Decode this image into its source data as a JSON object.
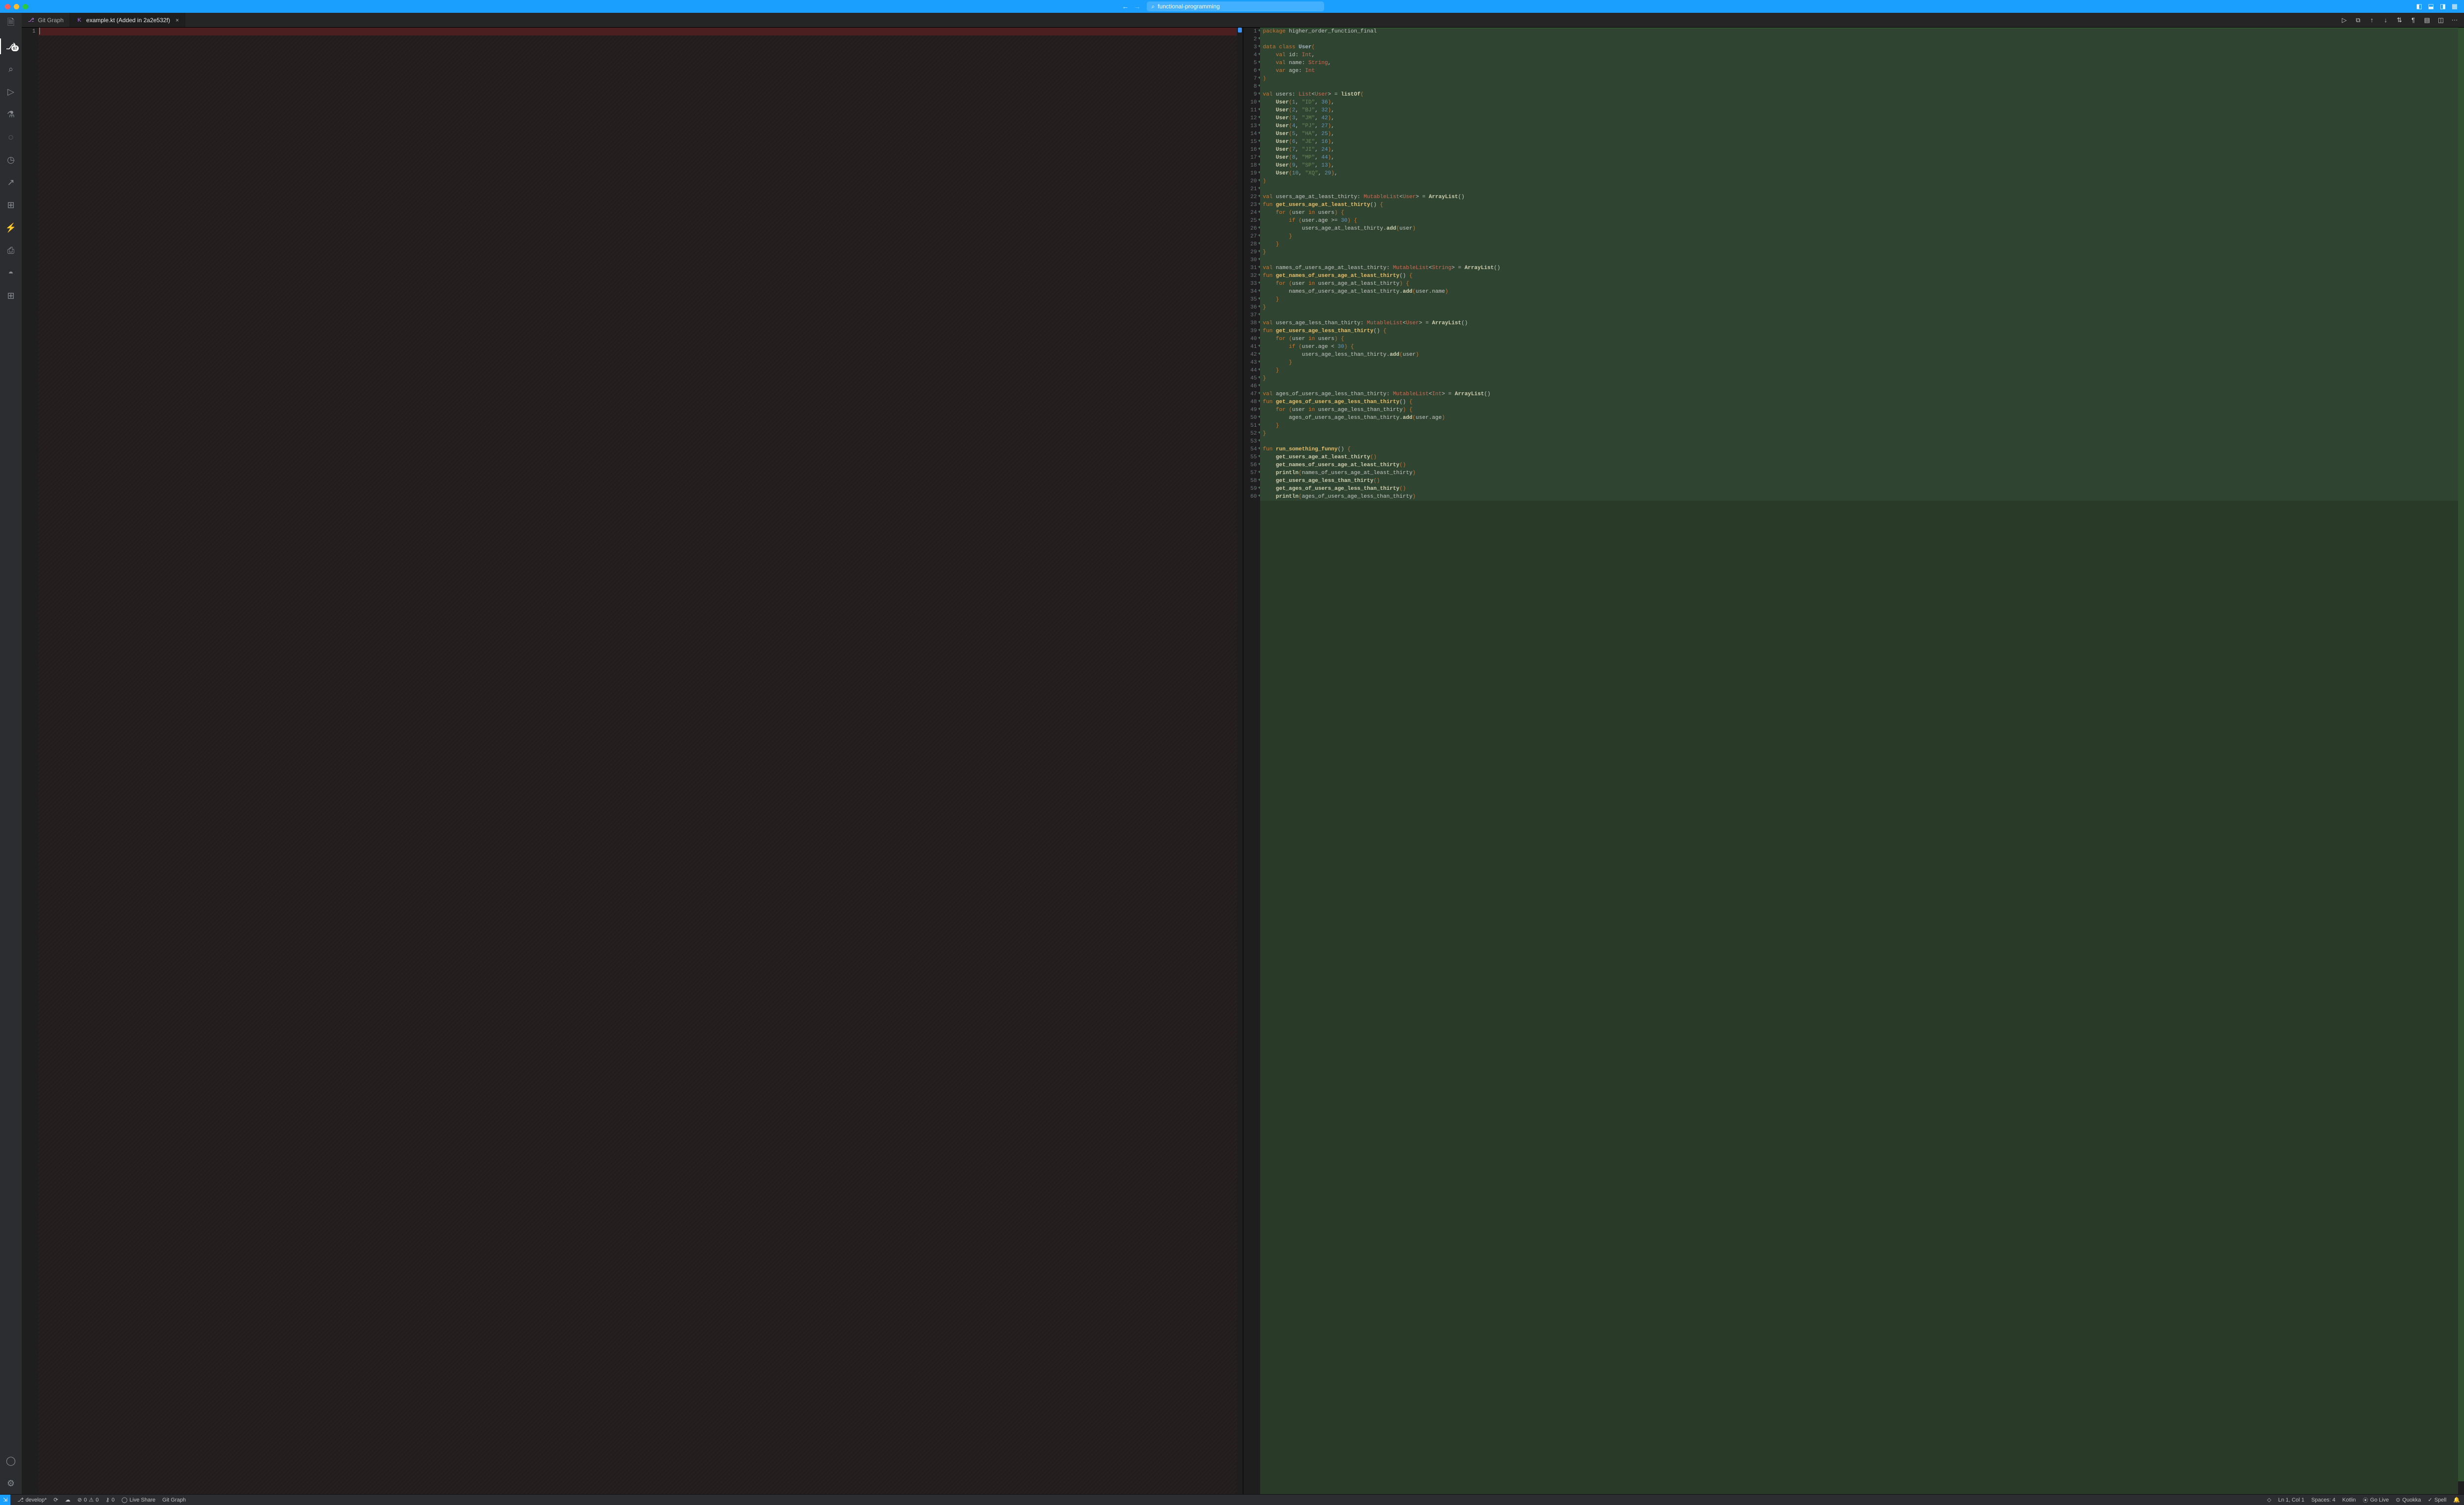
{
  "titlebar": {
    "search_placeholder": "functional-programming"
  },
  "tabs": [
    {
      "label": "Git Graph",
      "icon_name": "git-graph-icon"
    },
    {
      "label": "example.kt (Added in 2a2e532f)",
      "icon_name": "kotlin-file-icon"
    }
  ],
  "activitybar": {
    "scm_badge": "67"
  },
  "diff": {
    "left": {
      "line_numbers": [
        "1"
      ]
    },
    "right": {
      "start_line": 1
    }
  },
  "code": {
    "lines": [
      [
        [
          "k-keyword",
          "package"
        ],
        [
          "k-plain",
          " higher_order_function_final"
        ]
      ],
      [],
      [
        [
          "k-keyword",
          "data class"
        ],
        [
          "k-plain",
          " "
        ],
        [
          "k-class",
          "User"
        ],
        [
          "k-punct",
          "("
        ]
      ],
      [
        [
          "k-plain",
          "    "
        ],
        [
          "k-keyword",
          "val"
        ],
        [
          "k-plain",
          " id: "
        ],
        [
          "k-type",
          "Int"
        ],
        [
          "k-plain",
          ","
        ]
      ],
      [
        [
          "k-plain",
          "    "
        ],
        [
          "k-keyword",
          "val"
        ],
        [
          "k-plain",
          " name: "
        ],
        [
          "k-type",
          "String"
        ],
        [
          "k-plain",
          ","
        ]
      ],
      [
        [
          "k-plain",
          "    "
        ],
        [
          "k-keyword",
          "var"
        ],
        [
          "k-plain",
          " age: "
        ],
        [
          "k-type",
          "Int"
        ]
      ],
      [
        [
          "k-punct",
          ")"
        ]
      ],
      [],
      [
        [
          "k-keyword",
          "val"
        ],
        [
          "k-plain",
          " users: "
        ],
        [
          "k-type",
          "List"
        ],
        [
          "k-plain",
          "<"
        ],
        [
          "k-type",
          "User"
        ],
        [
          "k-plain",
          "> = "
        ],
        [
          "k-call",
          "listOf"
        ],
        [
          "k-punct",
          "("
        ]
      ],
      [
        [
          "k-plain",
          "    "
        ],
        [
          "k-call",
          "User"
        ],
        [
          "k-punct",
          "("
        ],
        [
          "k-number",
          "1"
        ],
        [
          "k-plain",
          ", "
        ],
        [
          "k-string",
          "\"ID\""
        ],
        [
          "k-plain",
          ", "
        ],
        [
          "k-number",
          "36"
        ],
        [
          "k-punct",
          ")"
        ],
        [
          "k-plain",
          ","
        ]
      ],
      [
        [
          "k-plain",
          "    "
        ],
        [
          "k-call",
          "User"
        ],
        [
          "k-punct",
          "("
        ],
        [
          "k-number",
          "2"
        ],
        [
          "k-plain",
          ", "
        ],
        [
          "k-string",
          "\"BJ\""
        ],
        [
          "k-plain",
          ", "
        ],
        [
          "k-number",
          "32"
        ],
        [
          "k-punct",
          ")"
        ],
        [
          "k-plain",
          ","
        ]
      ],
      [
        [
          "k-plain",
          "    "
        ],
        [
          "k-call",
          "User"
        ],
        [
          "k-punct",
          "("
        ],
        [
          "k-number",
          "3"
        ],
        [
          "k-plain",
          ", "
        ],
        [
          "k-string",
          "\"JM\""
        ],
        [
          "k-plain",
          ", "
        ],
        [
          "k-number",
          "42"
        ],
        [
          "k-punct",
          ")"
        ],
        [
          "k-plain",
          ","
        ]
      ],
      [
        [
          "k-plain",
          "    "
        ],
        [
          "k-call",
          "User"
        ],
        [
          "k-punct",
          "("
        ],
        [
          "k-number",
          "4"
        ],
        [
          "k-plain",
          ", "
        ],
        [
          "k-string",
          "\"PJ\""
        ],
        [
          "k-plain",
          ", "
        ],
        [
          "k-number",
          "27"
        ],
        [
          "k-punct",
          ")"
        ],
        [
          "k-plain",
          ","
        ]
      ],
      [
        [
          "k-plain",
          "    "
        ],
        [
          "k-call",
          "User"
        ],
        [
          "k-punct",
          "("
        ],
        [
          "k-number",
          "5"
        ],
        [
          "k-plain",
          ", "
        ],
        [
          "k-string",
          "\"HA\""
        ],
        [
          "k-plain",
          ", "
        ],
        [
          "k-number",
          "25"
        ],
        [
          "k-punct",
          ")"
        ],
        [
          "k-plain",
          ","
        ]
      ],
      [
        [
          "k-plain",
          "    "
        ],
        [
          "k-call",
          "User"
        ],
        [
          "k-punct",
          "("
        ],
        [
          "k-number",
          "6"
        ],
        [
          "k-plain",
          ", "
        ],
        [
          "k-string",
          "\"JE\""
        ],
        [
          "k-plain",
          ", "
        ],
        [
          "k-number",
          "16"
        ],
        [
          "k-punct",
          ")"
        ],
        [
          "k-plain",
          ","
        ]
      ],
      [
        [
          "k-plain",
          "    "
        ],
        [
          "k-call",
          "User"
        ],
        [
          "k-punct",
          "("
        ],
        [
          "k-number",
          "7"
        ],
        [
          "k-plain",
          ", "
        ],
        [
          "k-string",
          "\"JI\""
        ],
        [
          "k-plain",
          ", "
        ],
        [
          "k-number",
          "24"
        ],
        [
          "k-punct",
          ")"
        ],
        [
          "k-plain",
          ","
        ]
      ],
      [
        [
          "k-plain",
          "    "
        ],
        [
          "k-call",
          "User"
        ],
        [
          "k-punct",
          "("
        ],
        [
          "k-number",
          "8"
        ],
        [
          "k-plain",
          ", "
        ],
        [
          "k-string",
          "\"MP\""
        ],
        [
          "k-plain",
          ", "
        ],
        [
          "k-number",
          "44"
        ],
        [
          "k-punct",
          ")"
        ],
        [
          "k-plain",
          ","
        ]
      ],
      [
        [
          "k-plain",
          "    "
        ],
        [
          "k-call",
          "User"
        ],
        [
          "k-punct",
          "("
        ],
        [
          "k-number",
          "9"
        ],
        [
          "k-plain",
          ", "
        ],
        [
          "k-string",
          "\"SP\""
        ],
        [
          "k-plain",
          ", "
        ],
        [
          "k-number",
          "13"
        ],
        [
          "k-punct",
          ")"
        ],
        [
          "k-plain",
          ","
        ]
      ],
      [
        [
          "k-plain",
          "    "
        ],
        [
          "k-call",
          "User"
        ],
        [
          "k-punct",
          "("
        ],
        [
          "k-number",
          "10"
        ],
        [
          "k-plain",
          ", "
        ],
        [
          "k-string",
          "\"XQ\""
        ],
        [
          "k-plain",
          ", "
        ],
        [
          "k-number",
          "29"
        ],
        [
          "k-punct",
          ")"
        ],
        [
          "k-plain",
          ","
        ]
      ],
      [
        [
          "k-punct",
          ")"
        ]
      ],
      [],
      [
        [
          "k-keyword",
          "val"
        ],
        [
          "k-plain",
          " users_age_at_least_thirty: "
        ],
        [
          "k-type",
          "MutableList"
        ],
        [
          "k-plain",
          "<"
        ],
        [
          "k-type",
          "User"
        ],
        [
          "k-plain",
          "> = "
        ],
        [
          "k-call",
          "ArrayList"
        ],
        [
          "k-plain",
          "()"
        ]
      ],
      [
        [
          "k-keyword",
          "fun"
        ],
        [
          "k-plain",
          " "
        ],
        [
          "k-fn",
          "get_users_age_at_least_thirty"
        ],
        [
          "k-plain",
          "() "
        ],
        [
          "k-punct",
          "{"
        ]
      ],
      [
        [
          "k-plain",
          "    "
        ],
        [
          "k-keyword",
          "for"
        ],
        [
          "k-plain",
          " "
        ],
        [
          "k-punct",
          "("
        ],
        [
          "k-plain",
          "user "
        ],
        [
          "k-keyword",
          "in"
        ],
        [
          "k-plain",
          " users"
        ],
        [
          "k-punct",
          ")"
        ],
        [
          "k-plain",
          " "
        ],
        [
          "k-punct",
          "{"
        ]
      ],
      [
        [
          "k-plain",
          "        "
        ],
        [
          "k-keyword",
          "if"
        ],
        [
          "k-plain",
          " "
        ],
        [
          "k-punct",
          "("
        ],
        [
          "k-plain",
          "user.age >= "
        ],
        [
          "k-number",
          "30"
        ],
        [
          "k-punct",
          ")"
        ],
        [
          "k-plain",
          " "
        ],
        [
          "k-punct",
          "{"
        ]
      ],
      [
        [
          "k-plain",
          "            users_age_at_least_thirty."
        ],
        [
          "k-call",
          "add"
        ],
        [
          "k-punct",
          "("
        ],
        [
          "k-plain",
          "user"
        ],
        [
          "k-punct",
          ")"
        ]
      ],
      [
        [
          "k-plain",
          "        "
        ],
        [
          "k-punct",
          "}"
        ]
      ],
      [
        [
          "k-plain",
          "    "
        ],
        [
          "k-punct",
          "}"
        ]
      ],
      [
        [
          "k-punct",
          "}"
        ]
      ],
      [],
      [
        [
          "k-keyword",
          "val"
        ],
        [
          "k-plain",
          " names_of_users_age_at_least_thirty: "
        ],
        [
          "k-type",
          "MutableList"
        ],
        [
          "k-plain",
          "<"
        ],
        [
          "k-type",
          "String"
        ],
        [
          "k-plain",
          "> = "
        ],
        [
          "k-call",
          "ArrayList"
        ],
        [
          "k-plain",
          "()"
        ]
      ],
      [
        [
          "k-keyword",
          "fun"
        ],
        [
          "k-plain",
          " "
        ],
        [
          "k-fn",
          "get_names_of_users_age_at_least_thirty"
        ],
        [
          "k-plain",
          "() "
        ],
        [
          "k-punct",
          "{"
        ]
      ],
      [
        [
          "k-plain",
          "    "
        ],
        [
          "k-keyword",
          "for"
        ],
        [
          "k-plain",
          " "
        ],
        [
          "k-punct",
          "("
        ],
        [
          "k-plain",
          "user "
        ],
        [
          "k-keyword",
          "in"
        ],
        [
          "k-plain",
          " users_age_at_least_thirty"
        ],
        [
          "k-punct",
          ")"
        ],
        [
          "k-plain",
          " "
        ],
        [
          "k-punct",
          "{"
        ]
      ],
      [
        [
          "k-plain",
          "        names_of_users_age_at_least_thirty."
        ],
        [
          "k-call",
          "add"
        ],
        [
          "k-punct",
          "("
        ],
        [
          "k-plain",
          "user.name"
        ],
        [
          "k-punct",
          ")"
        ]
      ],
      [
        [
          "k-plain",
          "    "
        ],
        [
          "k-punct",
          "}"
        ]
      ],
      [
        [
          "k-punct",
          "}"
        ]
      ],
      [],
      [
        [
          "k-keyword",
          "val"
        ],
        [
          "k-plain",
          " users_age_less_than_thirty: "
        ],
        [
          "k-type",
          "MutableList"
        ],
        [
          "k-plain",
          "<"
        ],
        [
          "k-type",
          "User"
        ],
        [
          "k-plain",
          "> = "
        ],
        [
          "k-call",
          "ArrayList"
        ],
        [
          "k-plain",
          "()"
        ]
      ],
      [
        [
          "k-keyword",
          "fun"
        ],
        [
          "k-plain",
          " "
        ],
        [
          "k-fn",
          "get_users_age_less_than_thirty"
        ],
        [
          "k-plain",
          "() "
        ],
        [
          "k-punct",
          "{"
        ]
      ],
      [
        [
          "k-plain",
          "    "
        ],
        [
          "k-keyword",
          "for"
        ],
        [
          "k-plain",
          " "
        ],
        [
          "k-punct",
          "("
        ],
        [
          "k-plain",
          "user "
        ],
        [
          "k-keyword",
          "in"
        ],
        [
          "k-plain",
          " users"
        ],
        [
          "k-punct",
          ")"
        ],
        [
          "k-plain",
          " "
        ],
        [
          "k-punct",
          "{"
        ]
      ],
      [
        [
          "k-plain",
          "        "
        ],
        [
          "k-keyword",
          "if"
        ],
        [
          "k-plain",
          " "
        ],
        [
          "k-punct",
          "("
        ],
        [
          "k-plain",
          "user.age < "
        ],
        [
          "k-number",
          "30"
        ],
        [
          "k-punct",
          ")"
        ],
        [
          "k-plain",
          " "
        ],
        [
          "k-punct",
          "{"
        ]
      ],
      [
        [
          "k-plain",
          "            users_age_less_than_thirty."
        ],
        [
          "k-call",
          "add"
        ],
        [
          "k-punct",
          "("
        ],
        [
          "k-plain",
          "user"
        ],
        [
          "k-punct",
          ")"
        ]
      ],
      [
        [
          "k-plain",
          "        "
        ],
        [
          "k-punct",
          "}"
        ]
      ],
      [
        [
          "k-plain",
          "    "
        ],
        [
          "k-punct",
          "}"
        ]
      ],
      [
        [
          "k-punct",
          "}"
        ]
      ],
      [],
      [
        [
          "k-keyword",
          "val"
        ],
        [
          "k-plain",
          " ages_of_users_age_less_than_thirty: "
        ],
        [
          "k-type",
          "MutableList"
        ],
        [
          "k-plain",
          "<"
        ],
        [
          "k-type",
          "Int"
        ],
        [
          "k-plain",
          "> = "
        ],
        [
          "k-call",
          "ArrayList"
        ],
        [
          "k-plain",
          "()"
        ]
      ],
      [
        [
          "k-keyword",
          "fun"
        ],
        [
          "k-plain",
          " "
        ],
        [
          "k-fn",
          "get_ages_of_users_age_less_than_thirty"
        ],
        [
          "k-plain",
          "() "
        ],
        [
          "k-punct",
          "{"
        ]
      ],
      [
        [
          "k-plain",
          "    "
        ],
        [
          "k-keyword",
          "for"
        ],
        [
          "k-plain",
          " "
        ],
        [
          "k-punct",
          "("
        ],
        [
          "k-plain",
          "user "
        ],
        [
          "k-keyword",
          "in"
        ],
        [
          "k-plain",
          " users_age_less_than_thirty"
        ],
        [
          "k-punct",
          ")"
        ],
        [
          "k-plain",
          " "
        ],
        [
          "k-punct",
          "{"
        ]
      ],
      [
        [
          "k-plain",
          "        ages_of_users_age_less_than_thirty."
        ],
        [
          "k-call",
          "add"
        ],
        [
          "k-punct",
          "("
        ],
        [
          "k-plain",
          "user.age"
        ],
        [
          "k-punct",
          ")"
        ]
      ],
      [
        [
          "k-plain",
          "    "
        ],
        [
          "k-punct",
          "}"
        ]
      ],
      [
        [
          "k-punct",
          "}"
        ]
      ],
      [],
      [
        [
          "k-keyword",
          "fun"
        ],
        [
          "k-plain",
          " "
        ],
        [
          "k-fn",
          "run_something_funny"
        ],
        [
          "k-plain",
          "() "
        ],
        [
          "k-punct",
          "{"
        ]
      ],
      [
        [
          "k-plain",
          "    "
        ],
        [
          "k-call",
          "get_users_age_at_least_thirty"
        ],
        [
          "k-punct",
          "()"
        ]
      ],
      [
        [
          "k-plain",
          "    "
        ],
        [
          "k-call",
          "get_names_of_users_age_at_least_thirty"
        ],
        [
          "k-punct",
          "()"
        ]
      ],
      [
        [
          "k-plain",
          "    "
        ],
        [
          "k-call",
          "println"
        ],
        [
          "k-punct",
          "("
        ],
        [
          "k-plain",
          "names_of_users_age_at_least_thirty"
        ],
        [
          "k-punct",
          ")"
        ]
      ],
      [
        [
          "k-plain",
          "    "
        ],
        [
          "k-call",
          "get_users_age_less_than_thirty"
        ],
        [
          "k-punct",
          "()"
        ]
      ],
      [
        [
          "k-plain",
          "    "
        ],
        [
          "k-call",
          "get_ages_of_users_age_less_than_thirty"
        ],
        [
          "k-punct",
          "()"
        ]
      ],
      [
        [
          "k-plain",
          "    "
        ],
        [
          "k-call",
          "println"
        ],
        [
          "k-punct",
          "("
        ],
        [
          "k-plain",
          "ages_of_users_age_less_than_thirty"
        ],
        [
          "k-punct",
          ")"
        ]
      ]
    ]
  },
  "statusbar": {
    "branch": "develop*",
    "sync": "↕",
    "errors": "0",
    "warnings": "0",
    "ports": "0",
    "liveshare": "Live Share",
    "gitgraph": "Git Graph",
    "ln_col": "Ln 1, Col 1",
    "spaces": "Spaces: 4",
    "language": "Kotlin",
    "golive": "Go Live",
    "quokka": "Quokka",
    "spell": "Spell"
  }
}
